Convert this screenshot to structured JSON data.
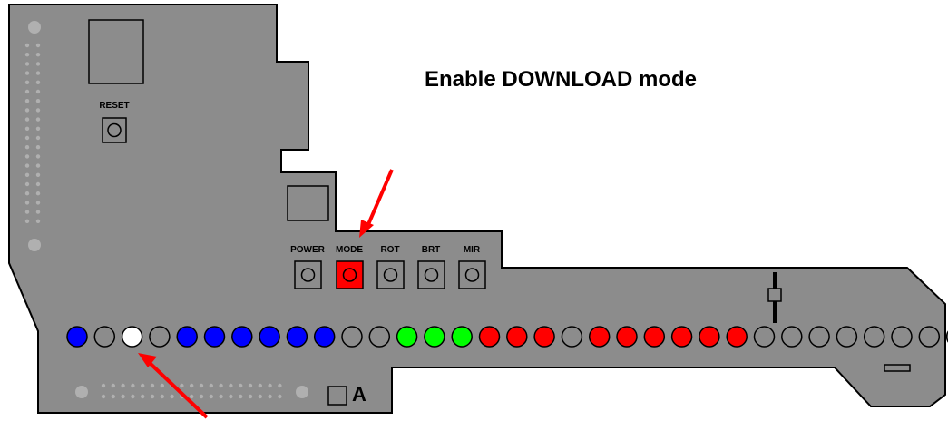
{
  "title": "Enable DOWNLOAD mode",
  "buttons": {
    "reset": "RESET",
    "power": "POWER",
    "mode": "MODE",
    "rot": "ROT",
    "brt": "BRT",
    "mir": "MIR"
  },
  "corner_label": "A",
  "colors": {
    "board": "#8c8c8c",
    "board_hole": "#b0b0b0",
    "mode_button": "#ff0000",
    "arrow": "#ff0000",
    "led_blue": "#0000ff",
    "led_green": "#00ff00",
    "led_red": "#ff0000",
    "led_white": "#ffffff",
    "led_off": "#8c8c8c"
  },
  "leds": [
    "blue",
    "off",
    "white",
    "off",
    "blue",
    "blue",
    "blue",
    "blue",
    "blue",
    "blue",
    "off",
    "off",
    "green",
    "green",
    "green",
    "red",
    "red",
    "red",
    "off",
    "red",
    "red",
    "red",
    "red",
    "red",
    "red",
    "off",
    "off",
    "off",
    "off",
    "off",
    "off",
    "off",
    "off"
  ]
}
